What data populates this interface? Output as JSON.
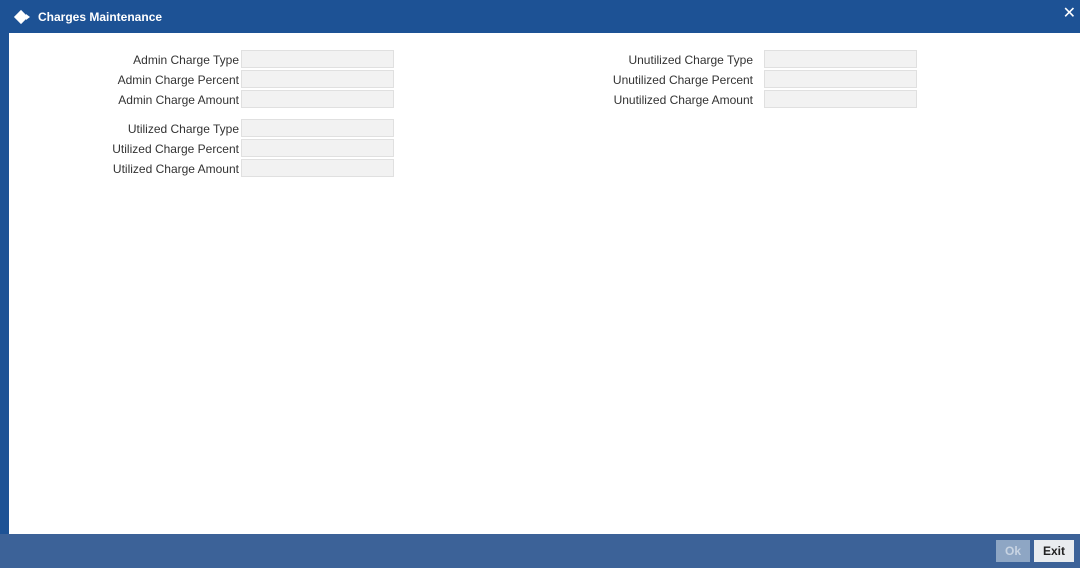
{
  "window": {
    "title": "Charges Maintenance",
    "close_glyph": "✕"
  },
  "left_fields": [
    {
      "label": "Admin Charge Type",
      "value": ""
    },
    {
      "label": "Admin Charge Percent",
      "value": ""
    },
    {
      "label": "Admin Charge Amount",
      "value": ""
    },
    {
      "label": "Utilized Charge Type",
      "value": ""
    },
    {
      "label": "Utilized Charge Percent",
      "value": ""
    },
    {
      "label": "Utilized Charge Amount",
      "value": ""
    }
  ],
  "right_fields": [
    {
      "label": "Unutilized Charge Type",
      "value": ""
    },
    {
      "label": "Unutilized Charge Percent",
      "value": ""
    },
    {
      "label": "Unutilized Charge Amount",
      "value": ""
    }
  ],
  "footer": {
    "ok_label": "Ok",
    "exit_label": "Exit"
  },
  "colors": {
    "titlebar": "#1d5295",
    "footer": "#3c6298",
    "field_bg": "#f2f2f2"
  }
}
